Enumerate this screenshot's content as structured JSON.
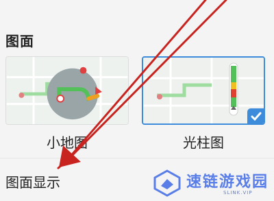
{
  "section": {
    "title": "图面"
  },
  "options": [
    {
      "label": "小地图",
      "selected": false
    },
    {
      "label": "光柱图",
      "selected": true
    }
  ],
  "settings_row": {
    "label": "图面显示"
  },
  "watermark": {
    "title": "速链游戏园",
    "subtitle": "SLINK.VIP"
  },
  "colors": {
    "selected_border": "#3d8bdb",
    "route_green": "#54c05a",
    "annotation_arrow": "#c8231f",
    "watermark_blue": "#5a7ee8"
  }
}
